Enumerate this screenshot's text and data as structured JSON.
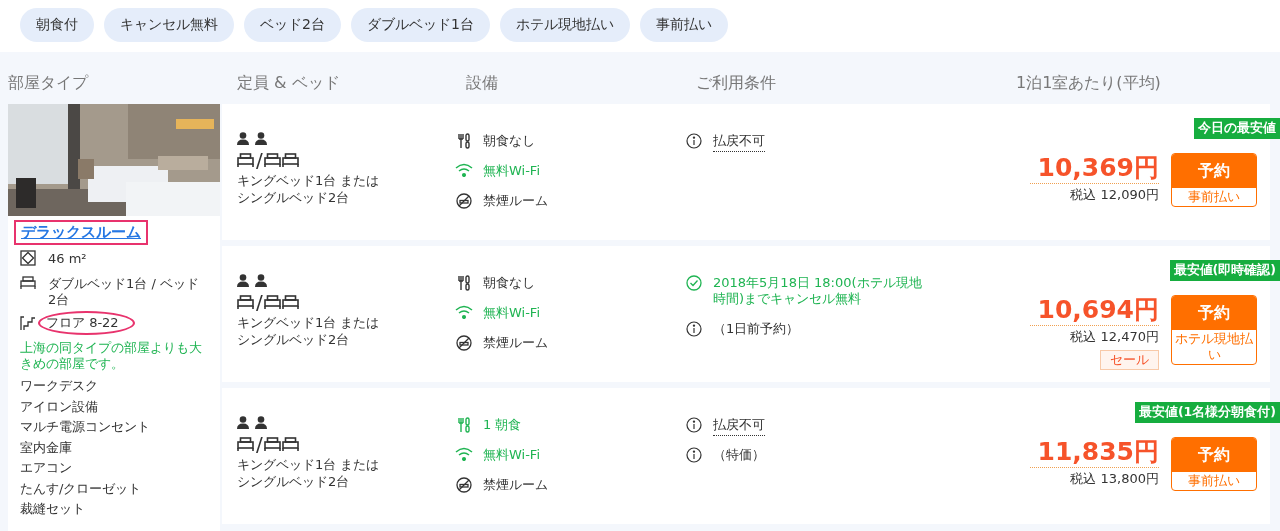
{
  "filters": [
    {
      "label": "朝食付"
    },
    {
      "label": "キャンセル無料"
    },
    {
      "label": "ベッド2台"
    },
    {
      "label": "ダブルベッド1台"
    },
    {
      "label": "ホテル現地払い"
    },
    {
      "label": "事前払い"
    }
  ],
  "columns": [
    "部屋タイプ",
    "定員 & ベッド",
    "設備",
    "ご利用条件",
    "1泊1室あたり(平均)"
  ],
  "room": {
    "name": "デラックスルーム",
    "name_highlighted": true,
    "details": [
      {
        "kind": "size",
        "text": "46 m²",
        "circled": false
      },
      {
        "kind": "bed",
        "text": "ダブルベッド1台 / ベッド2台",
        "circled": false
      },
      {
        "kind": "floor",
        "text": "フロア 8-22",
        "circled": true
      }
    ],
    "note": "上海の同タイプの部屋よりも大きめの部屋です。",
    "amenities": [
      "ワークデスク",
      "アイロン設備",
      "マルチ電源コンセント",
      "室内金庫",
      "エアコン",
      "たんす/クローゼット",
      "裁縫セット"
    ]
  },
  "rates": [
    {
      "bed_separator": "/",
      "bed_text": "キングベッド1台 またはシングルベッド2台",
      "facilities": [
        {
          "kind": "meal",
          "text": "朝食なし",
          "included": false
        },
        {
          "kind": "wifi",
          "text": "無料Wi-Fi",
          "included": true
        },
        {
          "kind": "nosmoking",
          "text": "禁煙ルーム",
          "included": false
        }
      ],
      "conditions": [
        {
          "kind": "info",
          "text": "払戻不可",
          "tooltip": true
        }
      ],
      "badge": "今日の最安値",
      "price": "10,369円",
      "tax_price": "税込 12,090円",
      "button": "予約",
      "payment": "事前払い"
    },
    {
      "bed_separator": "/",
      "bed_text": "キングベッド1台 またはシングルベッド2台",
      "facilities": [
        {
          "kind": "meal",
          "text": "朝食なし",
          "included": false
        },
        {
          "kind": "wifi",
          "text": "無料Wi-Fi",
          "included": true
        },
        {
          "kind": "nosmoking",
          "text": "禁煙ルーム",
          "included": false
        }
      ],
      "conditions": [
        {
          "kind": "check",
          "text": "2018年5月18日 18:00(ホテル現地時間)までキャンセル無料",
          "tooltip": false
        },
        {
          "kind": "info",
          "text": "（1日前予約）",
          "tooltip": false
        }
      ],
      "badge": "最安値(即時確認)",
      "price": "10,694円",
      "tax_price": "税込 12,470円",
      "sale_tag": "セール",
      "button": "予約",
      "payment": "ホテル現地払い"
    },
    {
      "bed_separator": "/",
      "bed_text": "キングベッド1台 またはシングルベッド2台",
      "facilities": [
        {
          "kind": "meal",
          "text": "1 朝食",
          "included": true
        },
        {
          "kind": "wifi",
          "text": "無料Wi-Fi",
          "included": true
        },
        {
          "kind": "nosmoking",
          "text": "禁煙ルーム",
          "included": false
        }
      ],
      "conditions": [
        {
          "kind": "info",
          "text": "払戻不可",
          "tooltip": true
        },
        {
          "kind": "info",
          "text": "（特価）",
          "tooltip": false
        }
      ],
      "badge": "最安値(1名様分朝食付)",
      "price": "11,835円",
      "tax_price": "税込 13,800円",
      "button": "予約",
      "payment": "事前払い"
    }
  ]
}
